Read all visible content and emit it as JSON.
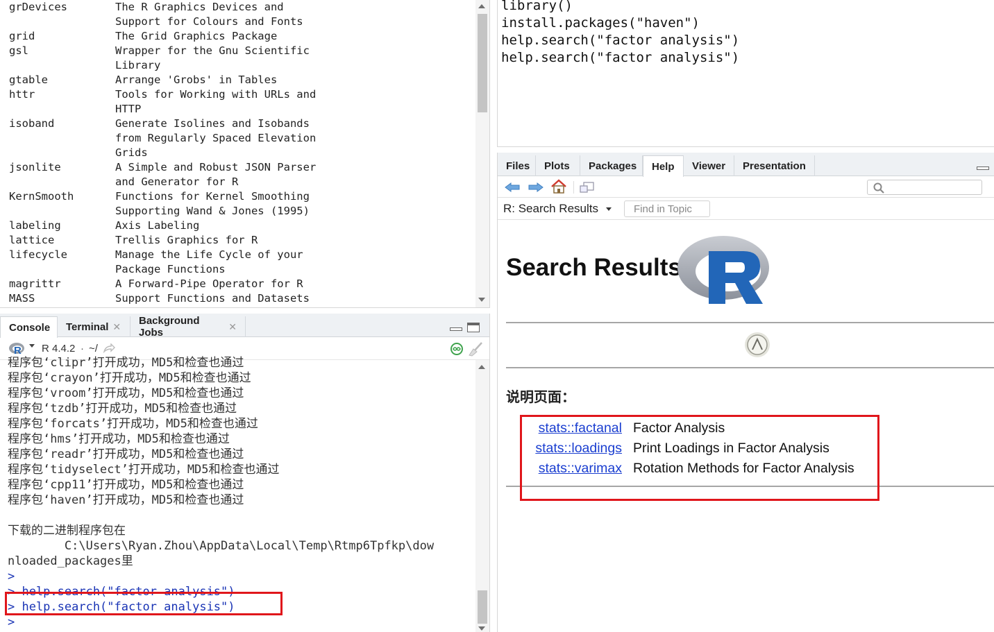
{
  "packages": [
    {
      "name": "grDevices",
      "desc": [
        "The R Graphics Devices and",
        "Support for Colours and Fonts"
      ]
    },
    {
      "name": "grid",
      "desc": [
        "The Grid Graphics Package"
      ]
    },
    {
      "name": "gsl",
      "desc": [
        "Wrapper for the Gnu Scientific",
        "Library"
      ]
    },
    {
      "name": "gtable",
      "desc": [
        "Arrange 'Grobs' in Tables"
      ]
    },
    {
      "name": "httr",
      "desc": [
        "Tools for Working with URLs and",
        "HTTP"
      ]
    },
    {
      "name": "isoband",
      "desc": [
        "Generate Isolines and Isobands",
        "from Regularly Spaced Elevation",
        "Grids"
      ]
    },
    {
      "name": "jsonlite",
      "desc": [
        "A Simple and Robust JSON Parser",
        "and Generator for R"
      ]
    },
    {
      "name": "KernSmooth",
      "desc": [
        "Functions for Kernel Smoothing",
        "Supporting Wand & Jones (1995)"
      ]
    },
    {
      "name": "labeling",
      "desc": [
        "Axis Labeling"
      ]
    },
    {
      "name": "lattice",
      "desc": [
        "Trellis Graphics for R"
      ]
    },
    {
      "name": "lifecycle",
      "desc": [
        "Manage the Life Cycle of your",
        "Package Functions"
      ]
    },
    {
      "name": "magrittr",
      "desc": [
        "A Forward-Pipe Operator for R"
      ]
    },
    {
      "name": "MASS",
      "desc": [
        "Support Functions and Datasets"
      ]
    }
  ],
  "console": {
    "tabs": [
      "Console",
      "Terminal",
      "Background Jobs"
    ],
    "r_version": "R 4.4.2",
    "path_sep": "·",
    "path": "~/",
    "lines": [
      {
        "text": "程序包‘clipr’打开成功，MD5和检查也通过",
        "type": "out"
      },
      {
        "text": "程序包‘crayon’打开成功，MD5和检查也通过",
        "type": "out"
      },
      {
        "text": "程序包‘vroom’打开成功，MD5和检查也通过",
        "type": "out"
      },
      {
        "text": "程序包‘tzdb’打开成功，MD5和检查也通过",
        "type": "out"
      },
      {
        "text": "程序包‘forcats’打开成功，MD5和检查也通过",
        "type": "out"
      },
      {
        "text": "程序包‘hms’打开成功，MD5和检查也通过",
        "type": "out"
      },
      {
        "text": "程序包‘readr’打开成功，MD5和检查也通过",
        "type": "out"
      },
      {
        "text": "程序包‘tidyselect’打开成功，MD5和检查也通过",
        "type": "out"
      },
      {
        "text": "程序包‘cpp11’打开成功，MD5和检查也通过",
        "type": "out"
      },
      {
        "text": "程序包‘haven’打开成功，MD5和检查也通过",
        "type": "out"
      },
      {
        "text": "",
        "type": "out"
      },
      {
        "text": "下载的二进制程序包在",
        "type": "out"
      },
      {
        "text": "        C:\\Users\\Ryan.Zhou\\AppData\\Local\\Temp\\Rtmp6Tpfkp\\dow",
        "type": "out"
      },
      {
        "text": "nloaded_packages里",
        "type": "out"
      },
      {
        "text": ">",
        "type": "cmd"
      },
      {
        "text": "> help.search(\"factor analysis\")",
        "type": "cmd"
      },
      {
        "text": "> help.search(\"factor analysis\")",
        "type": "cmd"
      },
      {
        "text": ">",
        "type": "cmd"
      }
    ]
  },
  "editor": {
    "lines": [
      "library()",
      "install.packages(\"haven\")",
      "help.search(\"factor analysis\")",
      "help.search(\"factor analysis\")"
    ]
  },
  "help": {
    "tabs": [
      "Files",
      "Plots",
      "Packages",
      "Help",
      "Viewer",
      "Presentation"
    ],
    "active_tab": "Help",
    "page_label": "R: Search Results",
    "find_in_topic": "Find in Topic",
    "heading": "Search Results",
    "section": "说明页面：",
    "results": [
      {
        "link": "stats::factanal",
        "desc": "Factor Analysis"
      },
      {
        "link": "stats::loadings",
        "desc": "Print Loadings in Factor Analysis"
      },
      {
        "link": "stats::varimax",
        "desc": "Rotation Methods for Factor Analysis"
      }
    ]
  },
  "colors": {
    "highlight_box": "#e0161b",
    "command_text": "#1a34b5",
    "link": "#1a3ed0",
    "r_logo_blue": "#2266b8"
  }
}
